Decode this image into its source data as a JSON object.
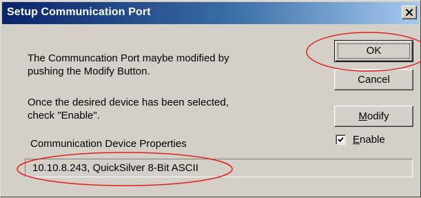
{
  "window": {
    "title": "Setup Communication Port",
    "close_icon": "close-icon"
  },
  "body": {
    "instruction_1_line1": "The Communcation Port maybe modified by",
    "instruction_1_line2": "pushing the Modify Button.",
    "instruction_2_line1": "Once the desired device has been selected,",
    "instruction_2_line2": "check \"Enable\".",
    "properties_label": "Communication Device Properties",
    "properties_value": "10.10.8.243, QuickSilver 8-Bit ASCII"
  },
  "buttons": {
    "ok_label": "OK",
    "cancel_label": "Cancel",
    "modify_mnemonic": "M",
    "modify_rest": "odify"
  },
  "enable": {
    "checked": true,
    "mnemonic": "E",
    "rest": "nable"
  },
  "annotations": {
    "ellipse_color": "#e0201c",
    "highlights": [
      "OK button",
      "device properties field"
    ]
  }
}
